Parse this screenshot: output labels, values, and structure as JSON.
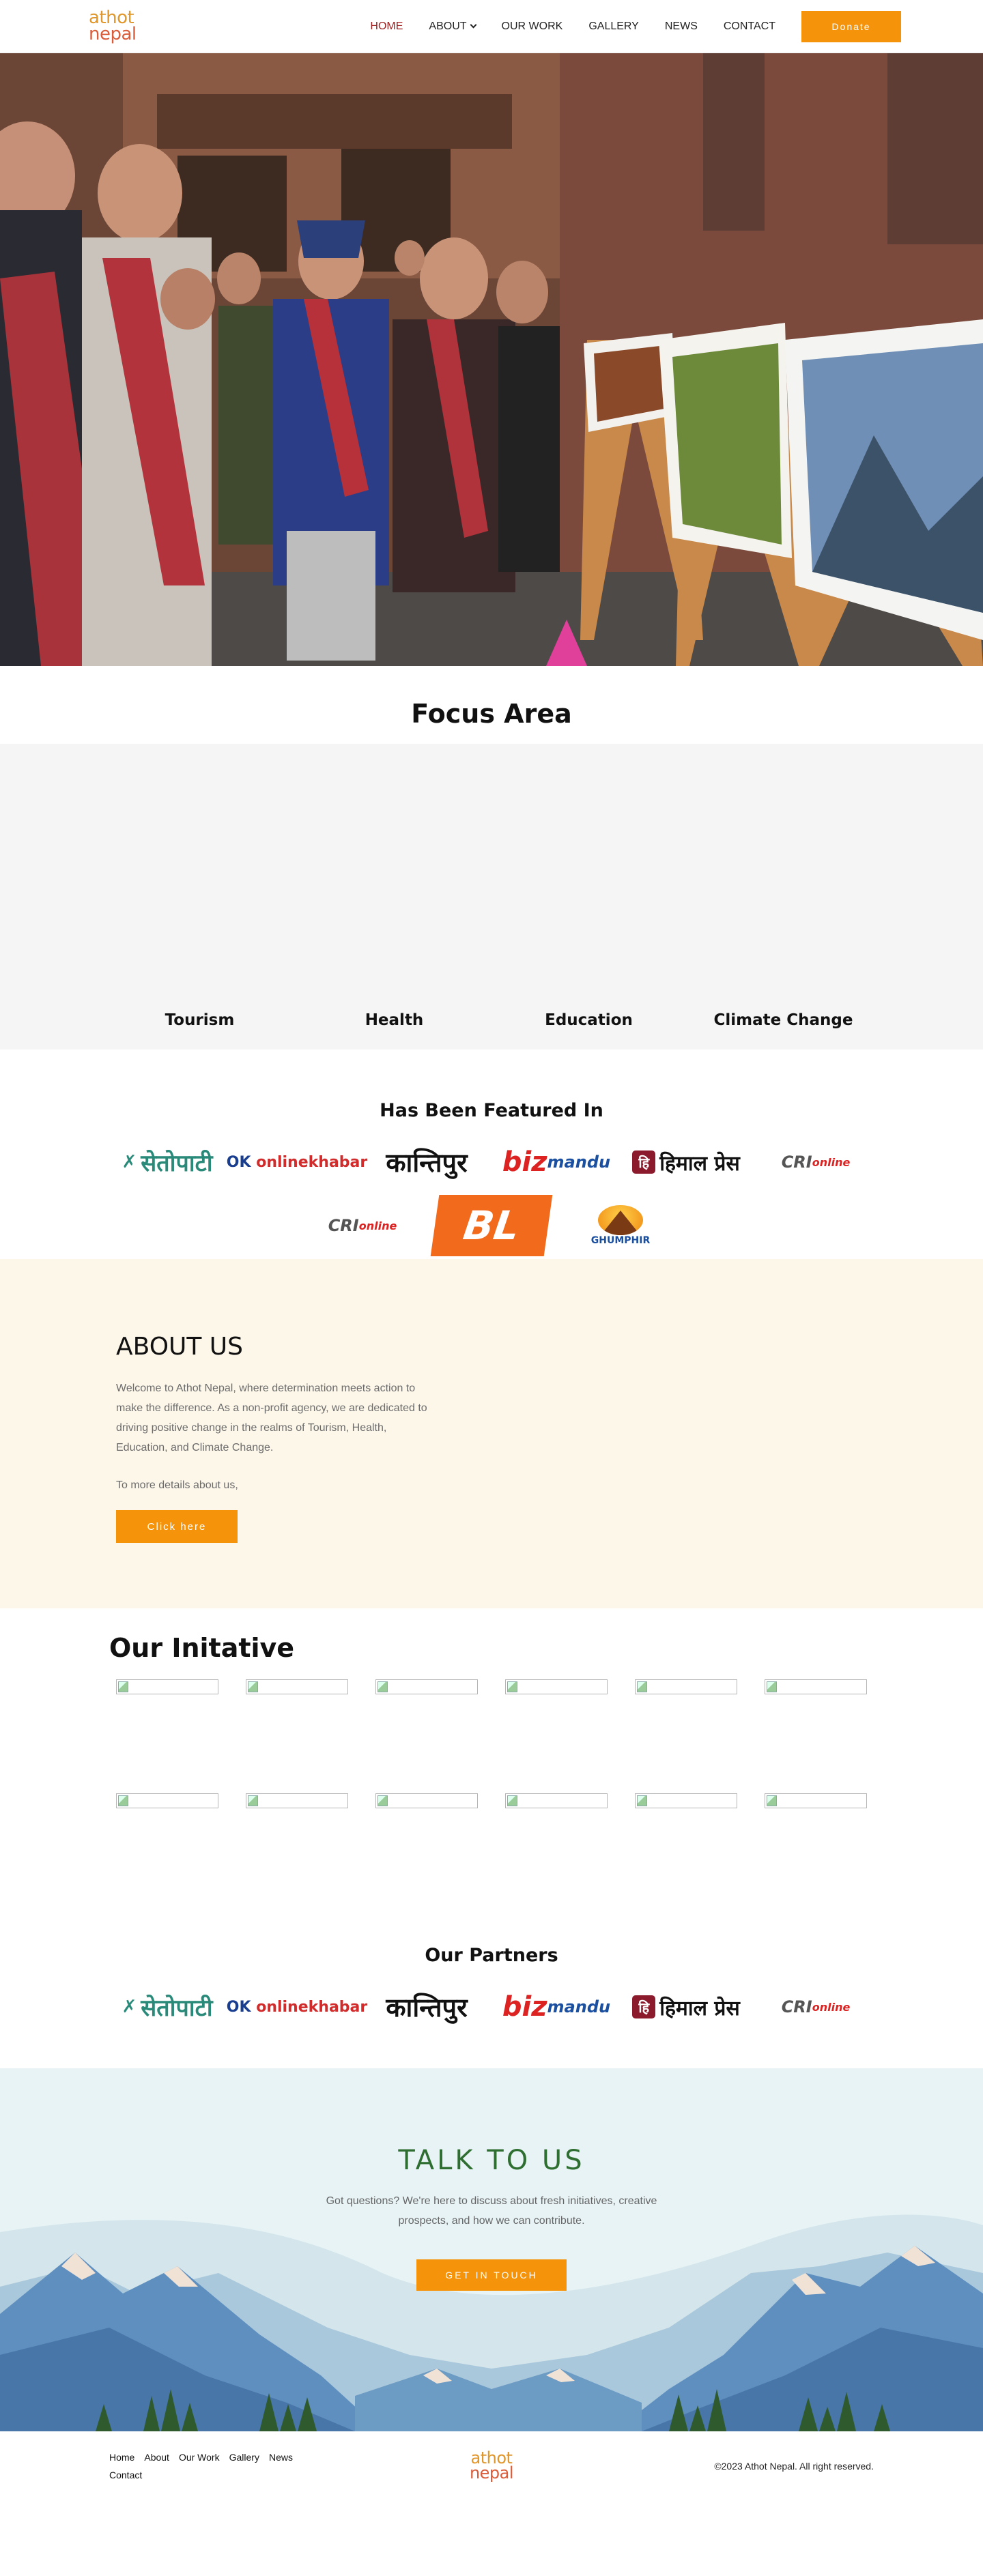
{
  "header": {
    "logo_line1": "athot",
    "logo_line2": "nepal",
    "nav": [
      "HOME",
      "ABOUT",
      "OUR WORK",
      "GALLERY",
      "NEWS",
      "CONTACT"
    ],
    "donate_label": "Donate"
  },
  "focus": {
    "title": "Focus Area",
    "items": [
      "Tourism",
      "Health",
      "Education",
      "Climate Change"
    ]
  },
  "featured": {
    "title": "Has Been Featured In",
    "row1": {
      "setopati": "सेतोपाटी",
      "onlinekhabar_ok": "OK",
      "onlinekhabar_text": "onlinekhabar",
      "kantipur": "कान्तिपुर",
      "bizmandu_biz": "biz",
      "bizmandu_mandu": "mandu",
      "himal_box": "हि",
      "himal": "हिमाल प्रेस",
      "cri": "CRI",
      "cri_online": "online"
    },
    "row2": {
      "cri": "CRI",
      "cri_online": "online",
      "bl": "BL",
      "ghumphir": "GHUMPHIR"
    }
  },
  "about": {
    "title": "ABOUT US",
    "body": "Welcome to Athot Nepal, where determination meets action to make the difference. As a non-profit agency, we are dedicated to driving positive change in the realms of Tourism, Health, Education, and Climate Change.",
    "more": "To more details about us,",
    "button": "Click here"
  },
  "initiative": {
    "title": "Our Initative"
  },
  "partners": {
    "title": "Our Partners"
  },
  "talk": {
    "title": "TALK TO US",
    "body": "Got questions? We're here to discuss about fresh initiatives, creative prospects, and how we can contribute.",
    "button": "GET IN TOUCH"
  },
  "footer": {
    "nav": [
      "Home",
      "About",
      "Our Work",
      "Gallery",
      "News",
      "Contact"
    ],
    "logo_line1": "athot",
    "logo_line2": "nepal",
    "copyright": "©2023 Athot Nepal. All right reserved."
  }
}
